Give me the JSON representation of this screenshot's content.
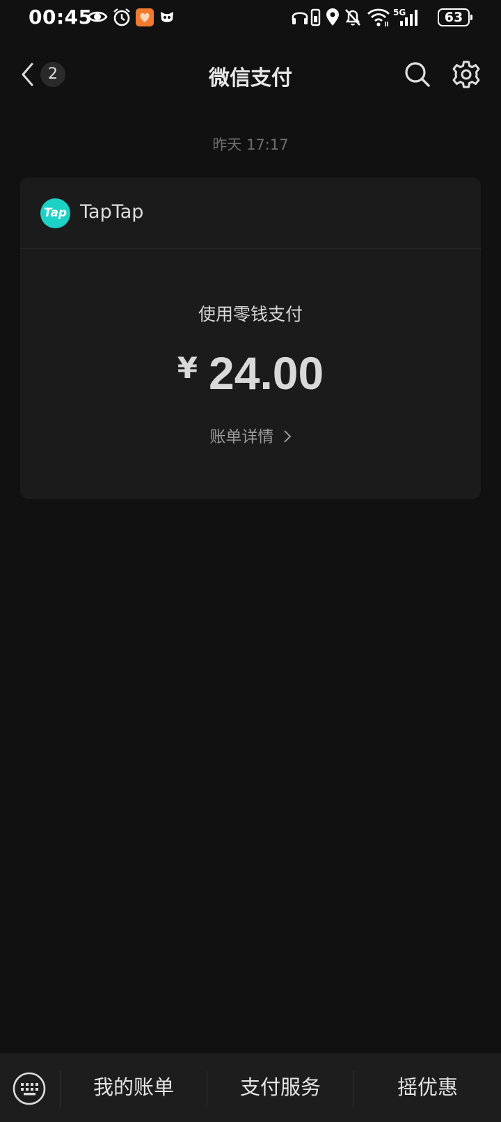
{
  "status_bar": {
    "time": "00:45",
    "battery": "63",
    "network": "5G",
    "icons": [
      "eye-icon",
      "alarm-icon",
      "app-notification-icon",
      "mask-icon",
      "headphones-icon",
      "vibrate-icon",
      "location-icon",
      "mute-icon",
      "wifi-icon",
      "signal-icon",
      "battery-icon"
    ]
  },
  "header": {
    "title": "微信支付",
    "unread_count": "2",
    "icons": [
      "back-arrow-icon",
      "search-icon",
      "gear-icon"
    ]
  },
  "timestamp": "昨天 17:17",
  "payment_card": {
    "merchant": {
      "name": "TapTap",
      "logo_text": "Tap",
      "logo_color": "#1cd1c6"
    },
    "method": "使用零钱支付",
    "currency_symbol": "¥",
    "amount": "24.00",
    "details_link": "账单详情"
  },
  "bottom_menu": {
    "items": [
      {
        "label": "我的账单"
      },
      {
        "label": "支付服务"
      },
      {
        "label": "摇优惠"
      }
    ],
    "icons": [
      "keyboard-icon"
    ]
  }
}
